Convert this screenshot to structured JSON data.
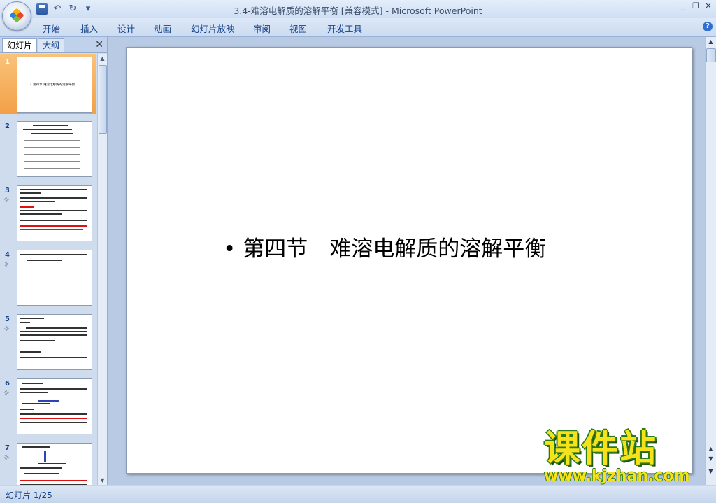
{
  "window": {
    "title_doc": "3.4-难溶电解质的溶解平衡 [兼容模式]",
    "title_sep": " - ",
    "title_app": "Microsoft PowerPoint",
    "controls": [
      "_",
      "❐",
      "✕"
    ]
  },
  "qat": {
    "undo_glyph": "↶",
    "redo_glyph": "↻",
    "more_glyph": "▾"
  },
  "ribbon_tabs": [
    {
      "label": "开始"
    },
    {
      "label": "插入"
    },
    {
      "label": "设计"
    },
    {
      "label": "动画"
    },
    {
      "label": "幻灯片放映"
    },
    {
      "label": "审阅"
    },
    {
      "label": "视图"
    },
    {
      "label": "开发工具"
    }
  ],
  "help_label": "?",
  "panel": {
    "tab_slides": "幻灯片",
    "tab_outline": "大纲",
    "close": "✕"
  },
  "thumbnails": [
    {
      "num": "1",
      "title": "• 第四节   难溶电解质的溶解平衡",
      "selected": true
    },
    {
      "num": "2"
    },
    {
      "num": "3",
      "anim": "☼"
    },
    {
      "num": "4",
      "anim": "☼"
    },
    {
      "num": "5",
      "anim": "☼"
    },
    {
      "num": "6",
      "anim": "☼"
    },
    {
      "num": "7",
      "anim": "☼"
    }
  ],
  "slide": {
    "bullet": "•",
    "text": "第四节　难溶电解质的溶解平衡"
  },
  "watermark": {
    "big": "课件站",
    "url": "www.kjzhan.com"
  },
  "status": {
    "slide_counter": "幻灯片 1/25"
  }
}
